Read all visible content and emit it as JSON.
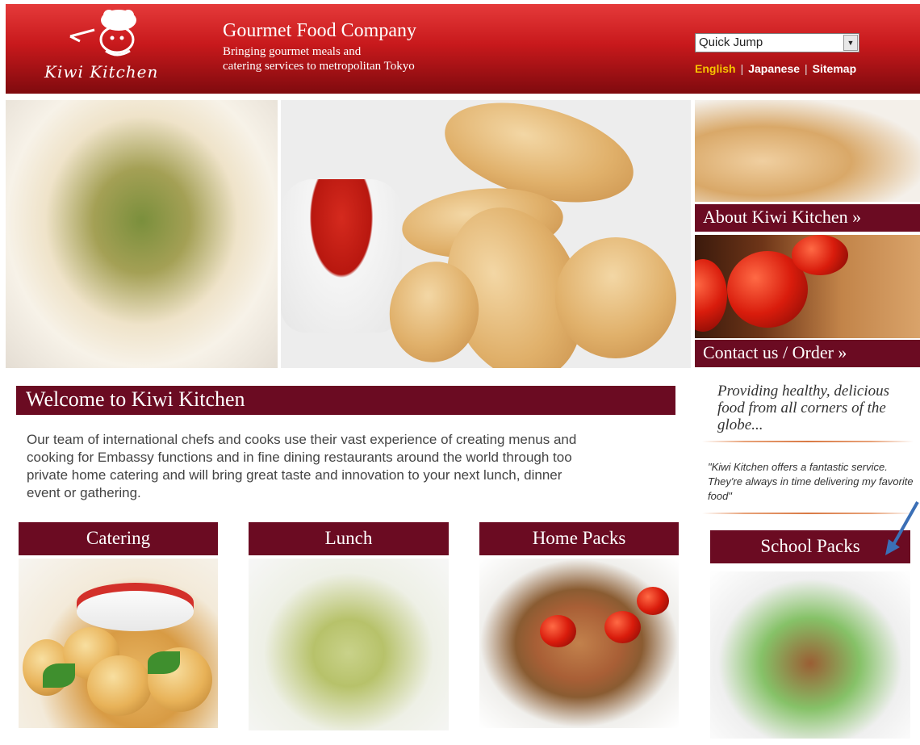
{
  "header": {
    "logo_text": "Kiwi Kitchen",
    "company_name": "Gourmet Food Company",
    "tagline_line1": "Bringing gourmet meals and",
    "tagline_line2": "catering services to metropolitan Tokyo",
    "quick_jump": {
      "selected": "Quick Jump"
    },
    "lang_nav": {
      "english": "English",
      "sep1": "|",
      "japanese": "Japanese",
      "sep2": "|",
      "sitemap": "Sitemap"
    }
  },
  "sidebar": {
    "about_label": "About Kiwi Kitchen »",
    "contact_label": "Contact us / Order »",
    "providing_text": "Providing healthy, delicious food from all corners of the globe...",
    "testimonial": "\"Kiwi Kitchen offers a fantastic service. They're always in time delivering my favorite food\""
  },
  "welcome": {
    "title": "Welcome to Kiwi Kitchen",
    "body": "Our team of international chefs and cooks use their vast experience of creating menus and cooking for Embassy functions and in fine dining restaurants around the world through too private home catering and will bring great taste and innovation to your next lunch, dinner event or gathering."
  },
  "categories": {
    "catering": "Catering",
    "lunch": "Lunch",
    "home_packs": "Home Packs",
    "school_packs": "School Packs"
  },
  "colors": {
    "brand_red": "#c8191c",
    "bar_maroon": "#6b0b22",
    "active_lang": "#f6c400",
    "annotation_arrow": "#3b6fb6"
  },
  "icons": {
    "chef_logo": "chef-logo-icon",
    "dropdown": "chevron-down-icon",
    "annotation": "arrow-annotation-icon"
  }
}
